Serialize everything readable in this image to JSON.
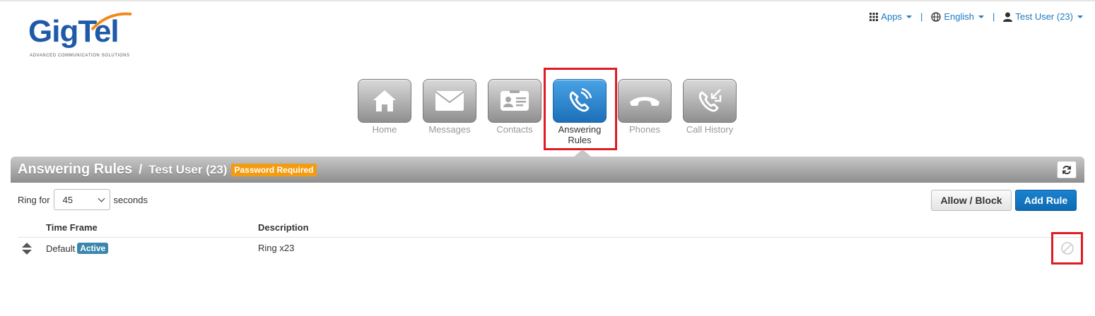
{
  "logo": {
    "text": "GigTel",
    "tagline": "ADVANCED COMMUNICATION SOLUTIONS"
  },
  "topnav": {
    "apps_label": "Apps",
    "language_label": "English",
    "user_label": "Test User (23)"
  },
  "tiles": [
    {
      "label": "Home",
      "icon": "home-icon",
      "active": false
    },
    {
      "label": "Messages",
      "icon": "envelope-icon",
      "active": false
    },
    {
      "label": "Contacts",
      "icon": "contact-card-icon",
      "active": false
    },
    {
      "label": "Answering\nRules",
      "icon": "phone-ringing-icon",
      "active": true
    },
    {
      "label": "Phones",
      "icon": "handset-icon",
      "active": false
    },
    {
      "label": "Call History",
      "icon": "call-history-icon",
      "active": false
    }
  ],
  "header": {
    "title": "Answering Rules",
    "separator": "/",
    "user": "Test User (23)",
    "badge": "Password Required"
  },
  "ring": {
    "prefix": "Ring for",
    "value": "45",
    "suffix": "seconds"
  },
  "buttons": {
    "allow_block": "Allow / Block",
    "add_rule": "Add Rule"
  },
  "table": {
    "columns": [
      "Time Frame",
      "Description"
    ],
    "rows": [
      {
        "time_frame": "Default",
        "status": "Active",
        "description": "Ring x23"
      }
    ]
  },
  "colors": {
    "accent": "#1f7bc1",
    "highlight": "#e01b24",
    "badge_warning": "#f49c10",
    "badge_info": "#3a87ad"
  }
}
